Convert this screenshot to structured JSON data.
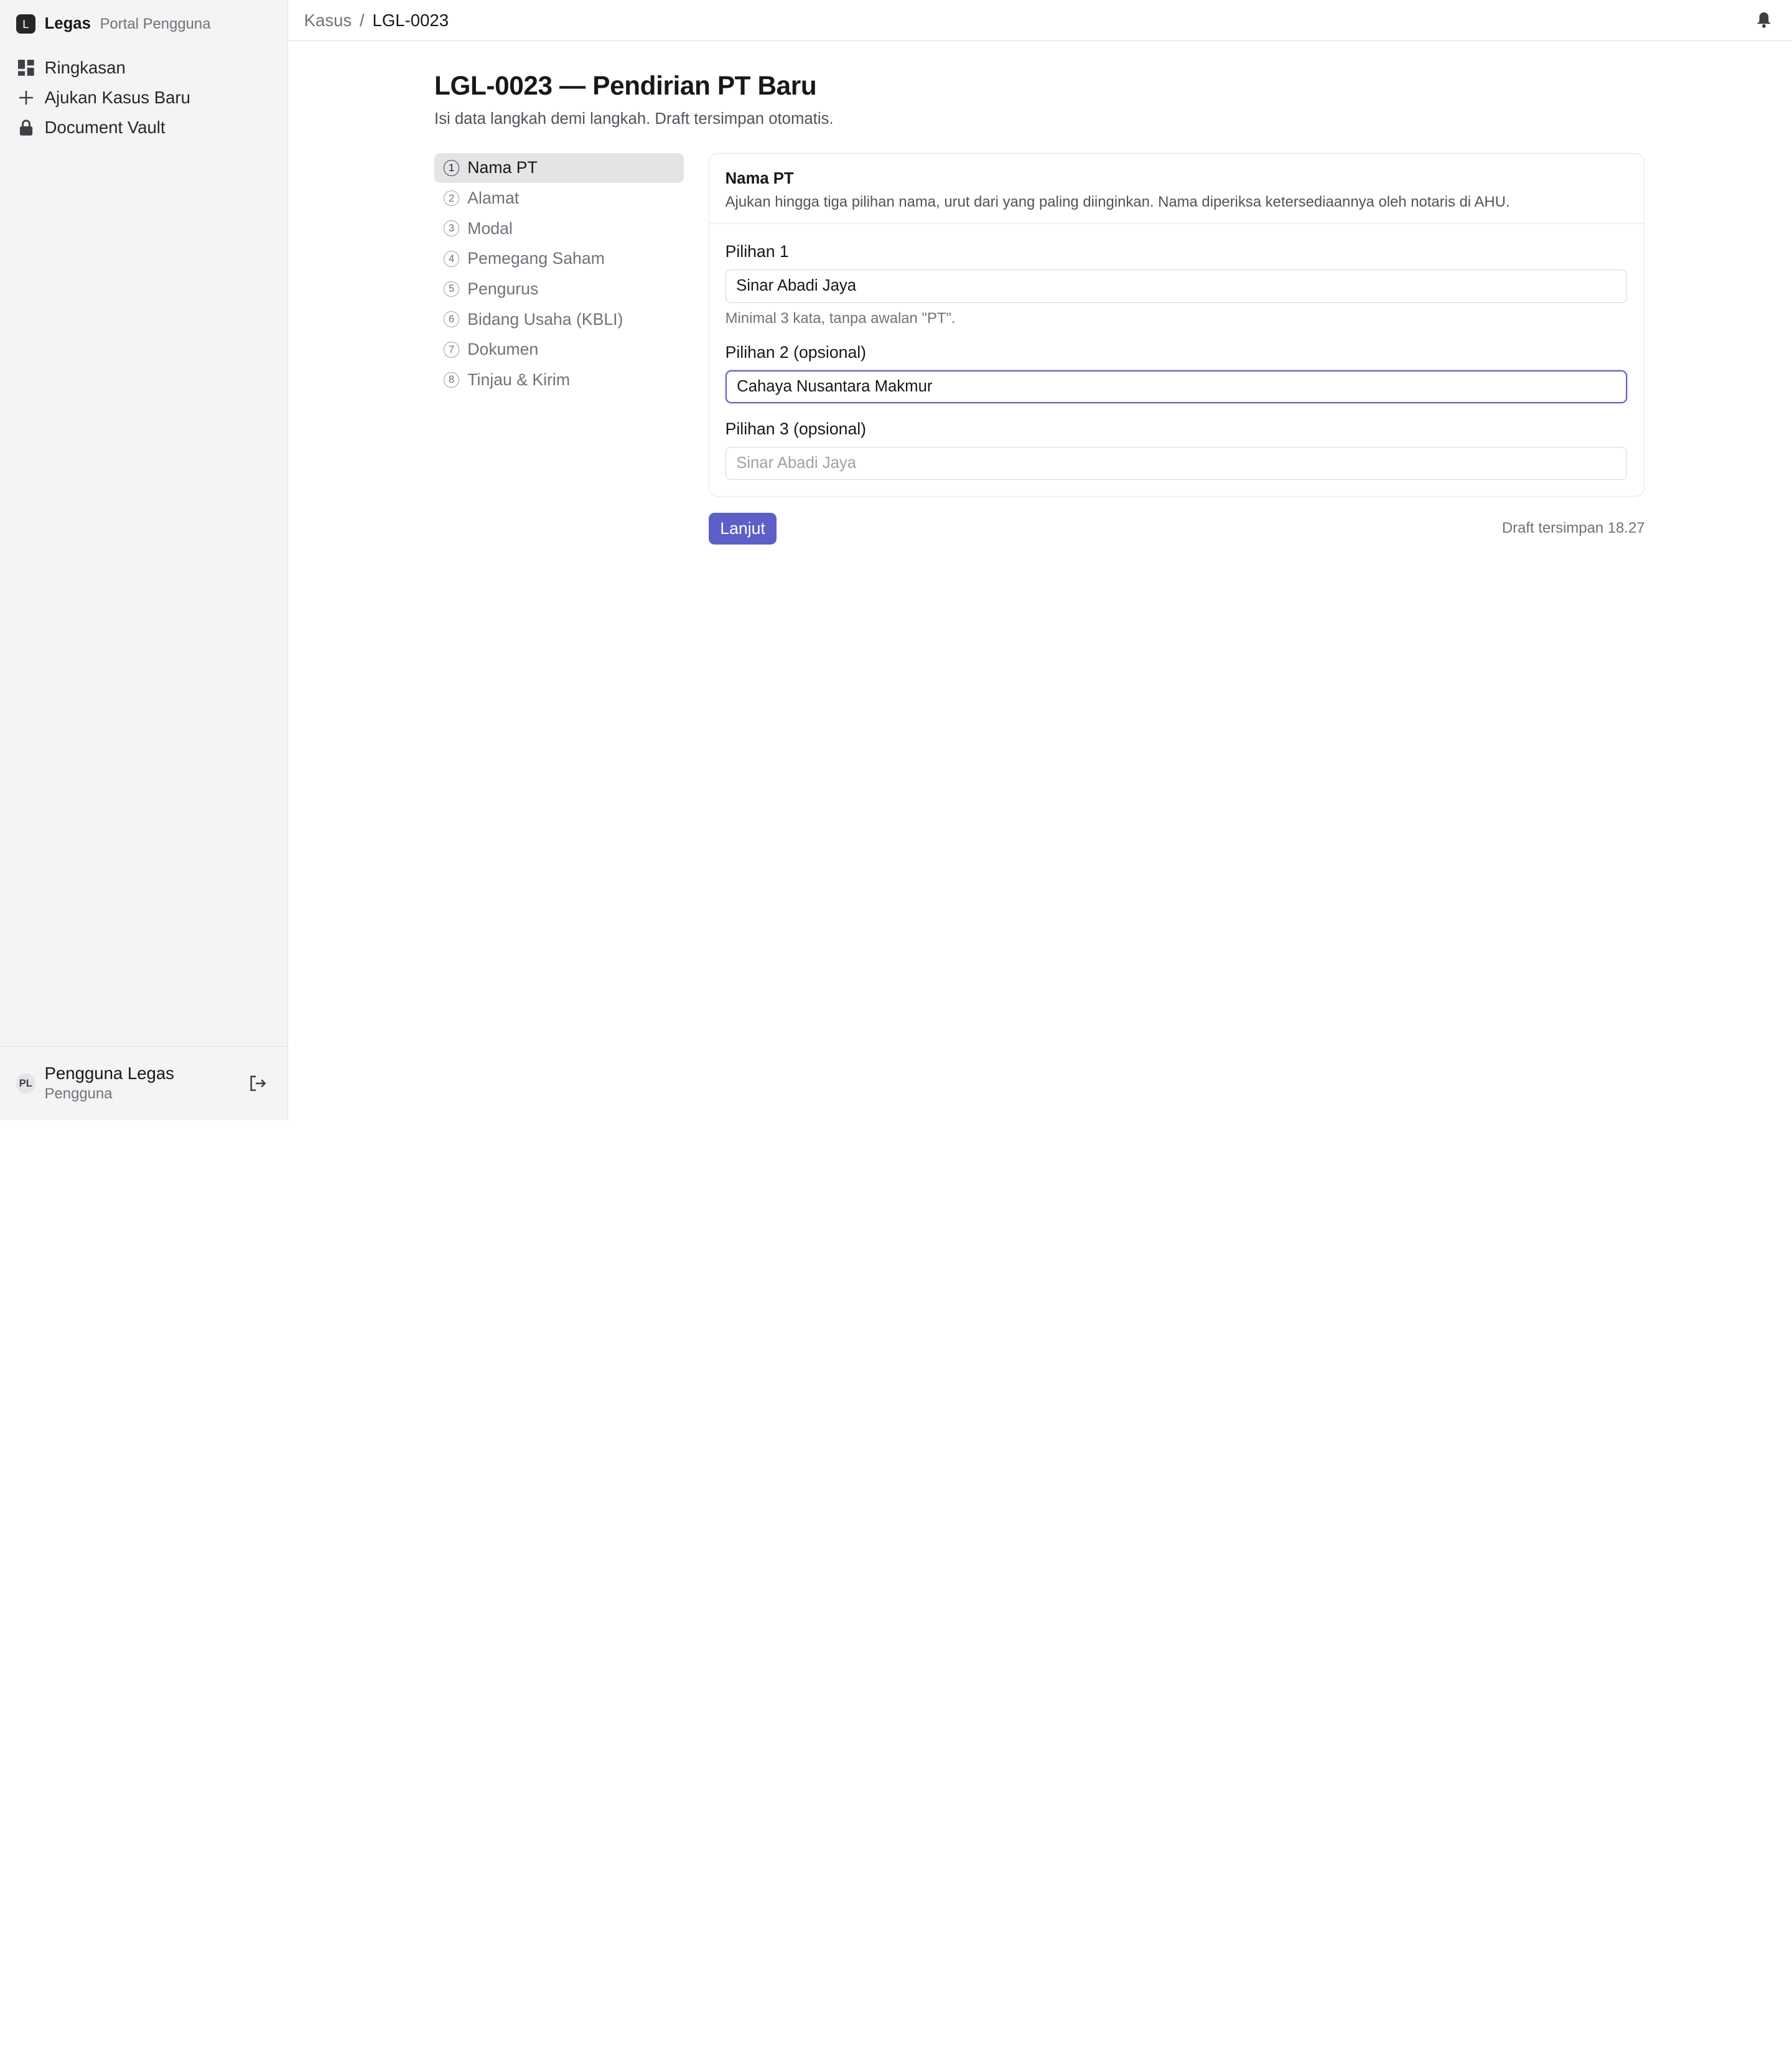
{
  "brand": {
    "logo_letter": "L",
    "name": "Legas",
    "subtitle": "Portal Pengguna"
  },
  "sidebar": {
    "items": [
      {
        "label": "Ringkasan",
        "icon": "dashboard-icon"
      },
      {
        "label": "Ajukan Kasus Baru",
        "icon": "plus-icon"
      },
      {
        "label": "Document Vault",
        "icon": "lock-icon"
      }
    ]
  },
  "user": {
    "initials": "PL",
    "name": "Pengguna Legas",
    "role": "Pengguna"
  },
  "breadcrumb": {
    "parent": "Kasus",
    "separator": "/",
    "current": "LGL-0023"
  },
  "page": {
    "title": "LGL-0023 — Pendirian PT Baru",
    "subtitle": "Isi data langkah demi langkah. Draft tersimpan otomatis."
  },
  "steps": [
    {
      "num": "1",
      "label": "Nama PT",
      "active": true
    },
    {
      "num": "2",
      "label": "Alamat"
    },
    {
      "num": "3",
      "label": "Modal"
    },
    {
      "num": "4",
      "label": "Pemegang Saham"
    },
    {
      "num": "5",
      "label": "Pengurus"
    },
    {
      "num": "6",
      "label": "Bidang Usaha (KBLI)"
    },
    {
      "num": "7",
      "label": "Dokumen"
    },
    {
      "num": "8",
      "label": "Tinjau & Kirim"
    }
  ],
  "form": {
    "title": "Nama PT",
    "description": "Ajukan hingga tiga pilihan nama, urut dari yang paling diinginkan. Nama diperiksa ketersediaannya oleh notaris di AHU.",
    "fields": [
      {
        "label": "Pilihan 1",
        "value": "Sinar Abadi Jaya",
        "placeholder": "",
        "hint": "Minimal 3 kata, tanpa awalan \"PT\"."
      },
      {
        "label": "Pilihan 2 (opsional)",
        "value": "Cahaya Nusantara Makmur",
        "placeholder": ""
      },
      {
        "label": "Pilihan 3 (opsional)",
        "value": "",
        "placeholder": "Sinar Abadi Jaya"
      }
    ]
  },
  "actions": {
    "next_label": "Lanjut",
    "saved_status": "Draft tersimpan 18.27"
  },
  "colors": {
    "accent": "#5b5fc7",
    "sidebar_bg": "#f4f4f5",
    "active_step_bg": "#e4e4e7"
  }
}
